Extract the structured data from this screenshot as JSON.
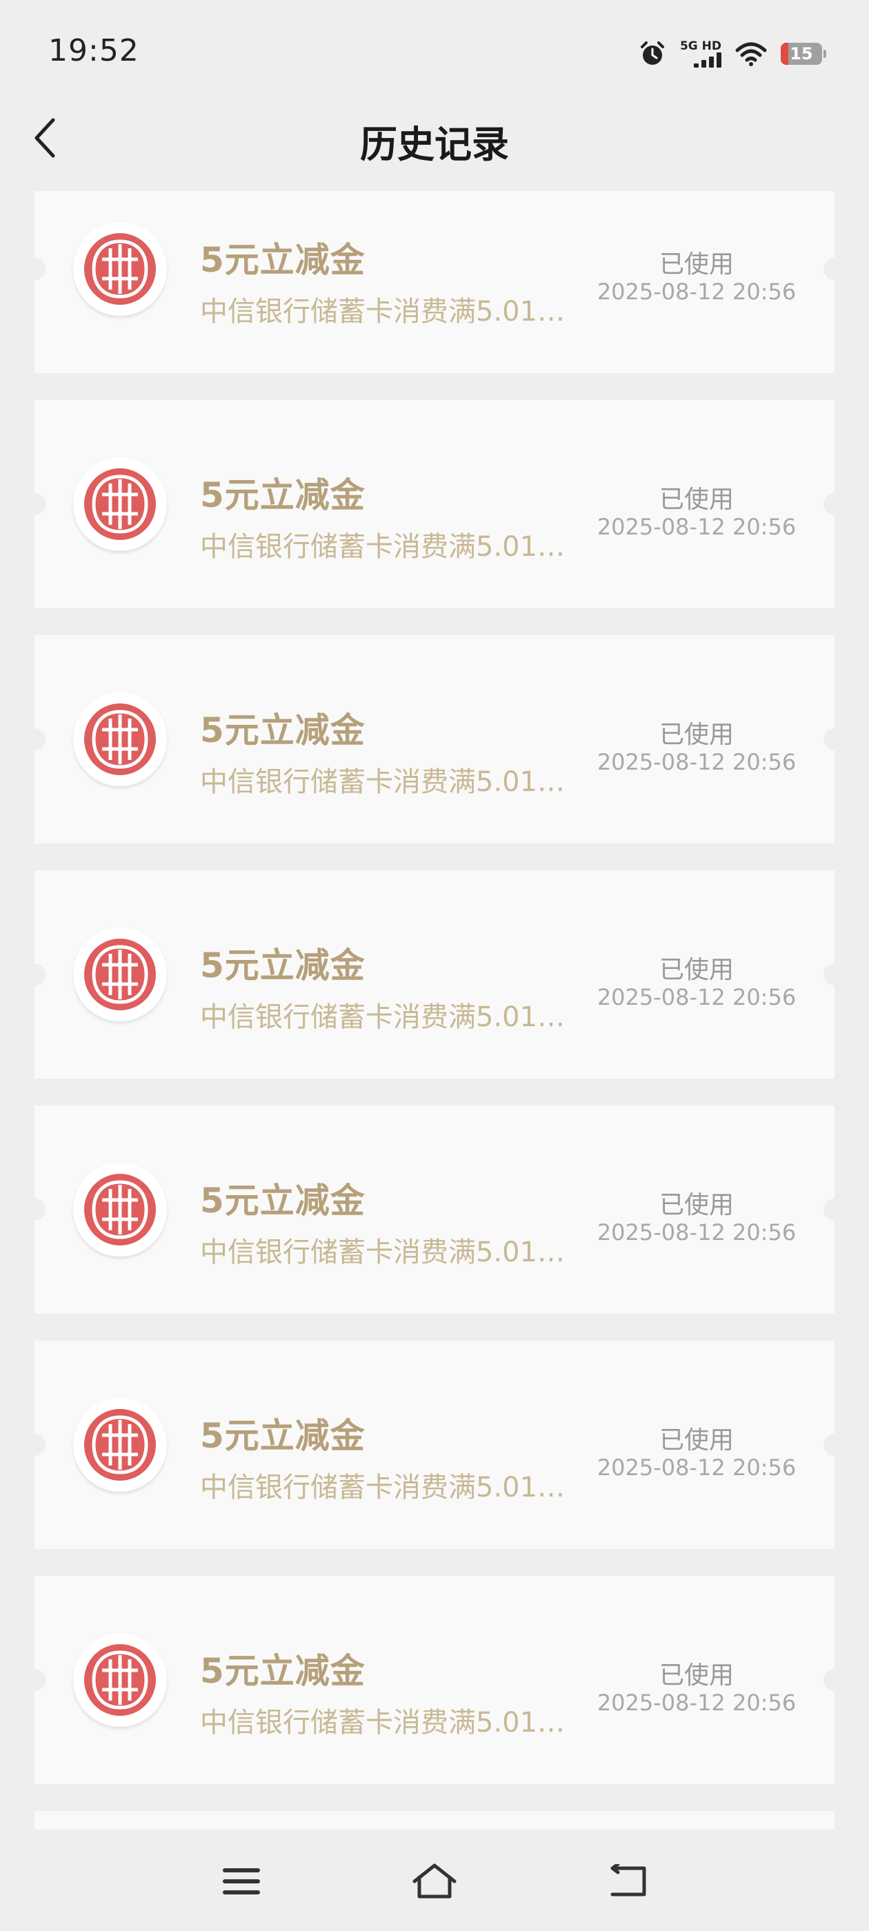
{
  "status_bar": {
    "time": "19:52",
    "network": "5G HD",
    "battery": "15",
    "icons": [
      "alarm-icon",
      "signal-icon",
      "wifi-icon",
      "battery-icon"
    ]
  },
  "header": {
    "title": "历史记录",
    "back_icon": "chevron-left-icon"
  },
  "colors": {
    "coupon_title": "#b5a07a",
    "coupon_desc": "#c8b894",
    "bank_logo": "#de5d5d",
    "card_bg": "#f9f9f9",
    "page_bg": "#eeeeee"
  },
  "records": [
    {
      "title": "5元立减金",
      "desc": "中信银行储蓄卡消费满5.01…",
      "status": "已使用",
      "date": "2025-08-12 20:56",
      "logo": "citic-bank-logo-icon"
    },
    {
      "title": "5元立减金",
      "desc": "中信银行储蓄卡消费满5.01…",
      "status": "已使用",
      "date": "2025-08-12 20:56",
      "logo": "citic-bank-logo-icon"
    },
    {
      "title": "5元立减金",
      "desc": "中信银行储蓄卡消费满5.01…",
      "status": "已使用",
      "date": "2025-08-12 20:56",
      "logo": "citic-bank-logo-icon"
    },
    {
      "title": "5元立减金",
      "desc": "中信银行储蓄卡消费满5.01…",
      "status": "已使用",
      "date": "2025-08-12 20:56",
      "logo": "citic-bank-logo-icon"
    },
    {
      "title": "5元立减金",
      "desc": "中信银行储蓄卡消费满5.01…",
      "status": "已使用",
      "date": "2025-08-12 20:56",
      "logo": "citic-bank-logo-icon"
    },
    {
      "title": "5元立减金",
      "desc": "中信银行储蓄卡消费满5.01…",
      "status": "已使用",
      "date": "2025-08-12 20:56",
      "logo": "citic-bank-logo-icon"
    },
    {
      "title": "5元立减金",
      "desc": "中信银行储蓄卡消费满5.01…",
      "status": "已使用",
      "date": "2025-08-12 20:56",
      "logo": "citic-bank-logo-icon"
    }
  ],
  "bottom_nav": {
    "icons": [
      "menu-icon",
      "home-icon",
      "return-icon"
    ]
  }
}
